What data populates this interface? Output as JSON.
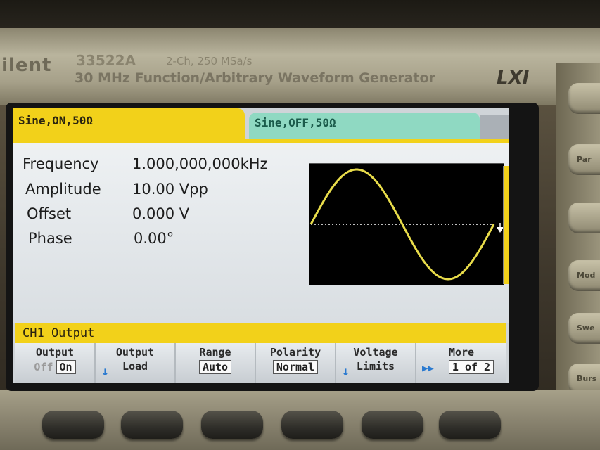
{
  "device": {
    "logo": "ilent",
    "model": "33522A",
    "spec": "2-Ch, 250 MSa/s",
    "description": "30 MHz Function/Arbitrary Waveform Generator",
    "lxi": "LXI"
  },
  "tabs": {
    "ch1": "Sine,ON,50Ω",
    "ch2": "Sine,OFF,50Ω"
  },
  "params": {
    "frequency_label": "Frequency",
    "frequency_value": "1.000,000,000kHz",
    "amplitude_label": "Amplitude",
    "amplitude_value": "10.00 Vpp",
    "offset_label": "Offset",
    "offset_value": "0.000 V",
    "phase_label": "Phase",
    "phase_value": "0.00°"
  },
  "waveform": {
    "type": "sine",
    "cycles": 1,
    "trace_color": "#e8dc4a",
    "baseline_color": "#ffffff"
  },
  "section_title": "CH1 Output",
  "softkeys": {
    "output_title": "Output",
    "output_off": "Off",
    "output_on": "On",
    "load_title": "Output",
    "load_sub": "Load",
    "range_title": "Range",
    "range_value": "Auto",
    "polarity_title": "Polarity",
    "polarity_value": "Normal",
    "limits_title": "Voltage",
    "limits_sub": "Limits",
    "more_title": "More",
    "more_value": "1 of 2"
  },
  "side_buttons": [
    "Par",
    "Mod",
    "Swe",
    "Burs"
  ],
  "colors": {
    "ch1": "#f2d11a",
    "ch2": "#8fd9c2",
    "screen_bg": "#e2e6e9",
    "accent_arrow": "#2a7ad0"
  }
}
